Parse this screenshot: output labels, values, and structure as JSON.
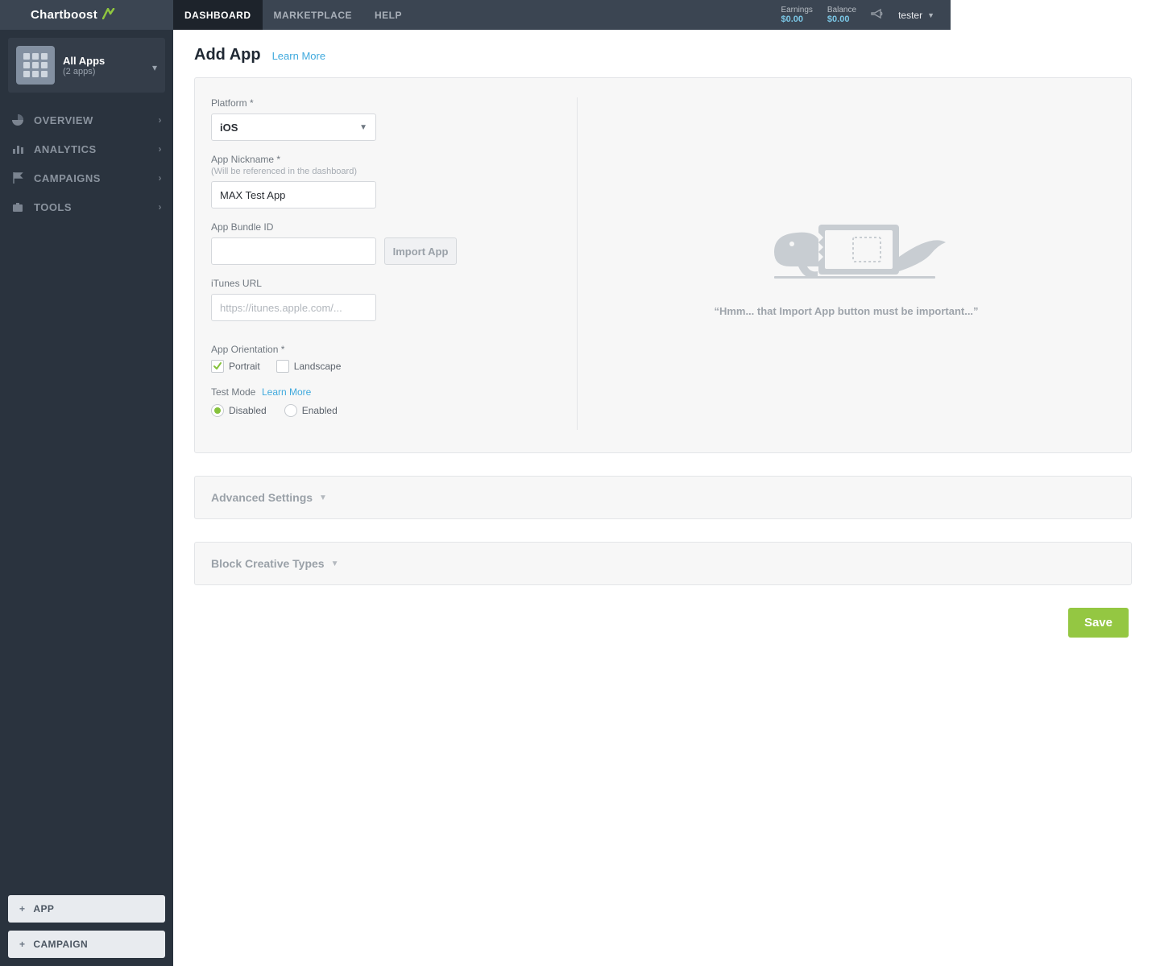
{
  "brand": {
    "name": "Chartboost"
  },
  "top_nav": {
    "items": [
      {
        "label": "DASHBOARD",
        "active": true
      },
      {
        "label": "MARKETPLACE",
        "active": false
      },
      {
        "label": "HELP",
        "active": false
      }
    ]
  },
  "header_stats": {
    "earnings": {
      "label": "Earnings",
      "value": "$0.00"
    },
    "balance": {
      "label": "Balance",
      "value": "$0.00"
    }
  },
  "user": {
    "name": "tester"
  },
  "sidebar": {
    "app_switch": {
      "title": "All Apps",
      "sub": "(2 apps)"
    },
    "nav": [
      {
        "icon": "pie-chart-icon",
        "label": "OVERVIEW"
      },
      {
        "icon": "bar-chart-icon",
        "label": "ANALYTICS"
      },
      {
        "icon": "flag-icon",
        "label": "CAMPAIGNS"
      },
      {
        "icon": "briefcase-icon",
        "label": "TOOLS"
      }
    ],
    "footer": {
      "add_app_label": "APP",
      "add_campaign_label": "CAMPAIGN"
    }
  },
  "page": {
    "title": "Add App",
    "learn_more": "Learn More"
  },
  "form": {
    "platform": {
      "label": "Platform *",
      "value": "iOS"
    },
    "nickname": {
      "label": "App Nickname *",
      "sub": "(Will be referenced in the dashboard)",
      "value": "MAX Test App"
    },
    "bundle_id": {
      "label": "App Bundle ID",
      "value": "",
      "import_label": "Import App"
    },
    "itunes": {
      "label": "iTunes URL",
      "placeholder": "https://itunes.apple.com/...",
      "value": ""
    },
    "orientation": {
      "label": "App Orientation *",
      "options": {
        "portrait": "Portrait",
        "landscape": "Landscape"
      },
      "portrait_checked": true,
      "landscape_checked": false
    },
    "test_mode": {
      "label": "Test Mode",
      "learn_more": "Learn More",
      "options": {
        "disabled": "Disabled",
        "enabled": "Enabled"
      },
      "value": "disabled"
    },
    "illustration_caption": "“Hmm... that Import App button must be important...”"
  },
  "collapsibles": {
    "advanced": {
      "title": "Advanced Settings"
    },
    "block_creative": {
      "title": "Block Creative Types"
    }
  },
  "actions": {
    "save": "Save"
  }
}
